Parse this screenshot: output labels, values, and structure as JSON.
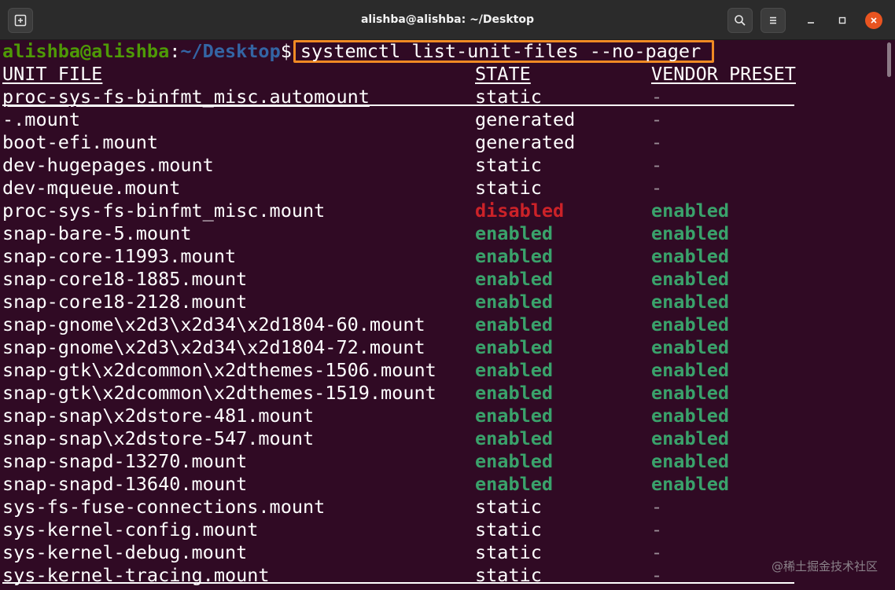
{
  "window": {
    "title": "alishba@alishba: ~/Desktop",
    "close_glyph": "✕",
    "max_glyph": "□",
    "min_glyph": "–"
  },
  "prompt": {
    "user_host": "alishba@alishba",
    "colon": ":",
    "path": "~/Desktop",
    "dollar": "$",
    "command": "systemctl list-unit-files --no-pager"
  },
  "table": {
    "headers": [
      "UNIT FILE",
      "STATE",
      "VENDOR PRESET"
    ],
    "rows": [
      [
        "proc-sys-fs-binfmt_misc.automount",
        "static",
        "-"
      ],
      [
        "-.mount",
        "generated",
        "-"
      ],
      [
        "boot-efi.mount",
        "generated",
        "-"
      ],
      [
        "dev-hugepages.mount",
        "static",
        "-"
      ],
      [
        "dev-mqueue.mount",
        "static",
        "-"
      ],
      [
        "proc-sys-fs-binfmt_misc.mount",
        "disabled",
        "enabled"
      ],
      [
        "snap-bare-5.mount",
        "enabled",
        "enabled"
      ],
      [
        "snap-core-11993.mount",
        "enabled",
        "enabled"
      ],
      [
        "snap-core18-1885.mount",
        "enabled",
        "enabled"
      ],
      [
        "snap-core18-2128.mount",
        "enabled",
        "enabled"
      ],
      [
        "snap-gnome\\x2d3\\x2d34\\x2d1804-60.mount",
        "enabled",
        "enabled"
      ],
      [
        "snap-gnome\\x2d3\\x2d34\\x2d1804-72.mount",
        "enabled",
        "enabled"
      ],
      [
        "snap-gtk\\x2dcommon\\x2dthemes-1506.mount",
        "enabled",
        "enabled"
      ],
      [
        "snap-gtk\\x2dcommon\\x2dthemes-1519.mount",
        "enabled",
        "enabled"
      ],
      [
        "snap-snap\\x2dstore-481.mount",
        "enabled",
        "enabled"
      ],
      [
        "snap-snap\\x2dstore-547.mount",
        "enabled",
        "enabled"
      ],
      [
        "snap-snapd-13270.mount",
        "enabled",
        "enabled"
      ],
      [
        "snap-snapd-13640.mount",
        "enabled",
        "enabled"
      ],
      [
        "sys-fs-fuse-connections.mount",
        "static",
        "-"
      ],
      [
        "sys-kernel-config.mount",
        "static",
        "-"
      ],
      [
        "sys-kernel-debug.mount",
        "static",
        "-"
      ],
      [
        "sys-kernel-tracing.mount",
        "static",
        "-"
      ]
    ]
  },
  "colors": {
    "background": "#300a24",
    "enabled": "#3aa26b",
    "disabled": "#cc2228",
    "highlight_box": "#f08a24"
  },
  "watermark": "@稀土掘金技术社区"
}
